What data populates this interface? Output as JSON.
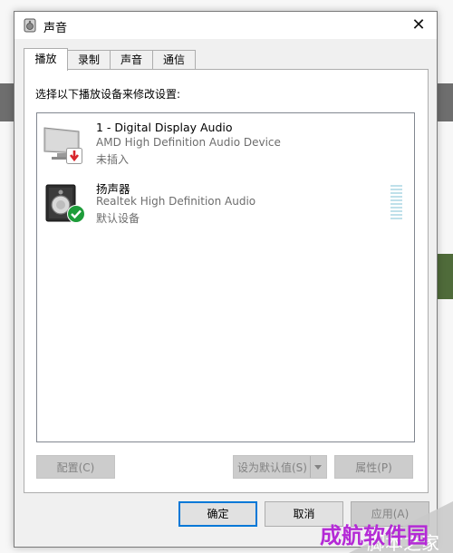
{
  "window": {
    "title": "声音",
    "close_glyph": "✕"
  },
  "tabs": [
    {
      "label": "播放",
      "active": true
    },
    {
      "label": "录制",
      "active": false
    },
    {
      "label": "声音",
      "active": false
    },
    {
      "label": "通信",
      "active": false
    }
  ],
  "panel": {
    "instruction": "选择以下播放设备来修改设置:"
  },
  "devices": [
    {
      "name": "1 - Digital Display Audio",
      "description": "AMD High Definition Audio Device",
      "status": "未插入",
      "icon": "monitor-icon",
      "badge": "unplugged-arrow-icon"
    },
    {
      "name": "扬声器",
      "description": "Realtek High Definition Audio",
      "status": "默认设备",
      "icon": "speaker-icon",
      "badge": "default-check-icon"
    }
  ],
  "panel_buttons": {
    "configure": "配置(C)",
    "set_default": "设为默认值(S)",
    "properties": "属性(P)"
  },
  "footer": {
    "ok": "确定",
    "cancel": "取消",
    "apply": "应用(A)"
  },
  "watermark": {
    "text": "成航软件园",
    "corner": "脚本之家"
  },
  "colors": {
    "accent": "#0078d7",
    "check_green": "#1e9c3a",
    "unplug_red": "#d8262c",
    "watermark": "#b42ad6"
  }
}
